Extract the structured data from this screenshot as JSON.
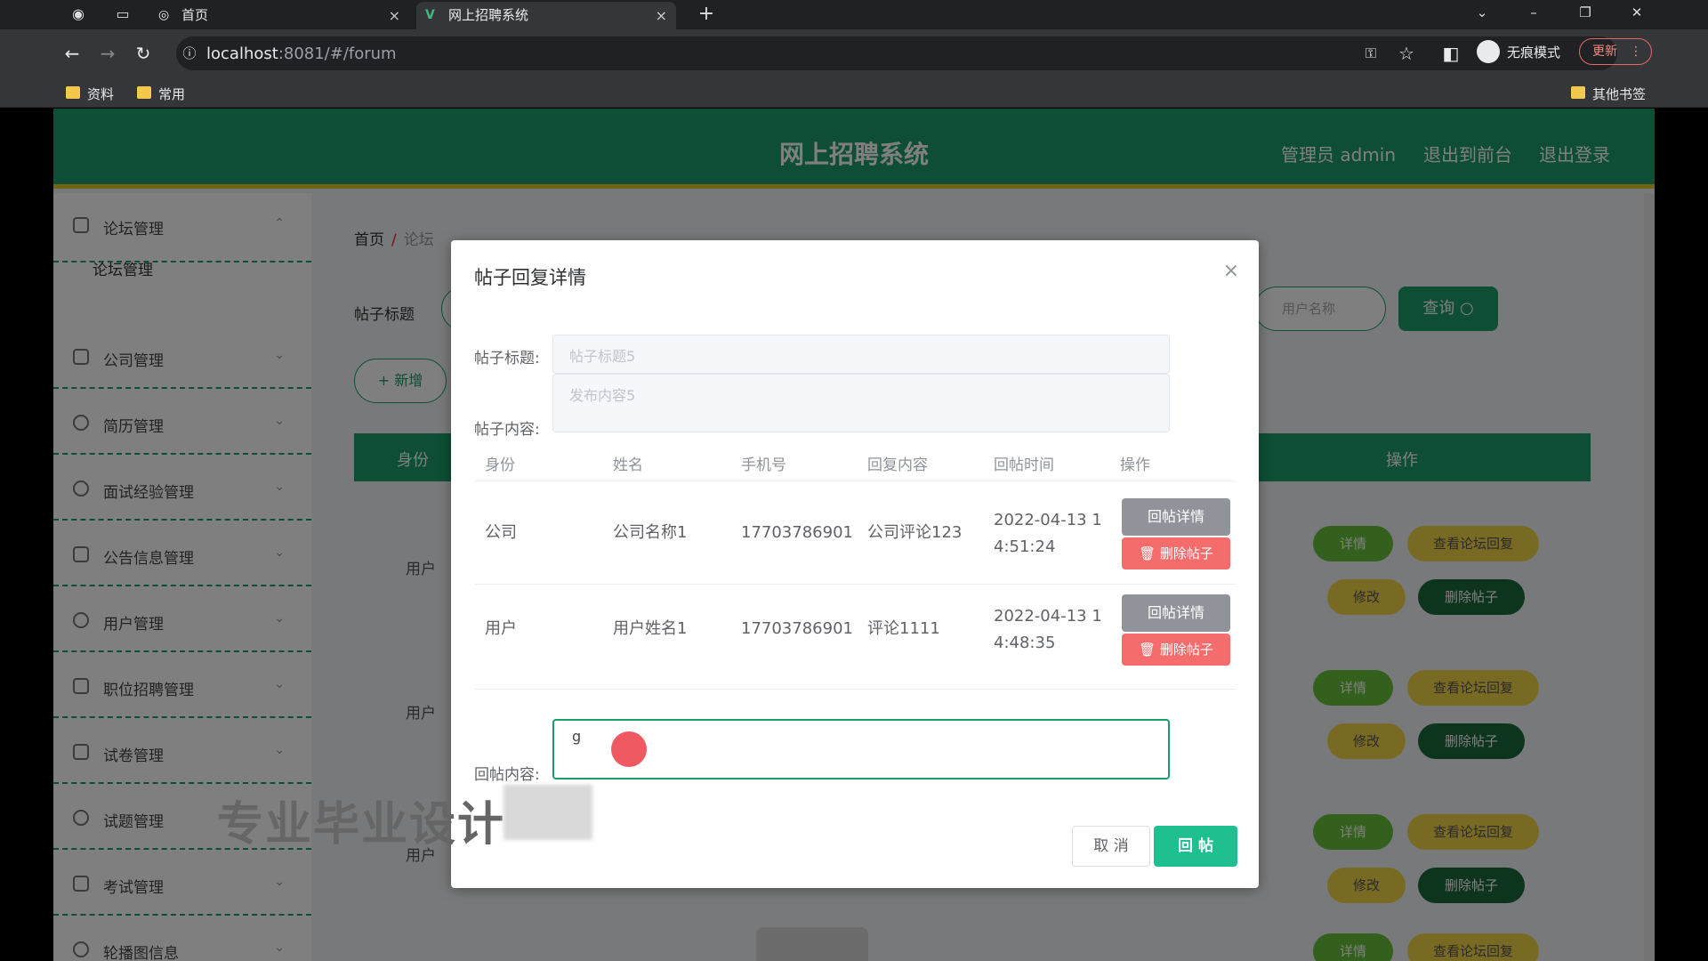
{
  "browser": {
    "tabs": [
      {
        "label": "首页",
        "close": "×"
      },
      {
        "label": "网上招聘系统",
        "close": "×"
      }
    ],
    "new_tab": "+",
    "url_host": "localhost",
    "url_rest": ":8081/#/forum",
    "incognito_label": "无痕模式",
    "update_label": "更新",
    "bookmarks": [
      "资料",
      "常用"
    ],
    "other_bookmarks": "其他书签"
  },
  "header": {
    "title": "网上招聘系统",
    "admin": "管理员 admin",
    "to_front": "退出到前台",
    "logout": "退出登录"
  },
  "sidebar": {
    "items": [
      "论坛管理",
      "公司管理",
      "简历管理",
      "面试经验管理",
      "公告信息管理",
      "用户管理",
      "职位招聘管理",
      "试卷管理",
      "试题管理",
      "考试管理",
      "轮播图信息"
    ],
    "sub_item": "论坛管理"
  },
  "content": {
    "breadcrumb_home": "首页",
    "breadcrumb_sep": "/",
    "breadcrumb_current": "论坛",
    "filter_label": "帖子标题",
    "filter2_placeholder": "用户名称",
    "query_button": "查询",
    "add_button": "+ 新增",
    "table_headers": {
      "identity": "身份",
      "action": "操作"
    },
    "row_labels": [
      "用户",
      "用户",
      "用户"
    ],
    "row_buttons": {
      "detail": "详情",
      "view_reply": "查看论坛回复",
      "edit": "修改",
      "delete": "删除帖子"
    }
  },
  "dialog": {
    "title": "帖子回复详情",
    "close": "×",
    "post_title_label": "帖子标题:",
    "post_title_value": "帖子标题5",
    "post_content_label": "帖子内容:",
    "post_content_value": "发布内容5",
    "table": {
      "headers": [
        "身份",
        "姓名",
        "手机号",
        "回复内容",
        "回帖时间",
        "操作"
      ],
      "rows": [
        {
          "identity": "公司",
          "name": "公司名称1",
          "phone": "17703786901",
          "content": "公司评论123",
          "time_line1": "2022-04-13 1",
          "time_line2": "4:51:24"
        },
        {
          "identity": "用户",
          "name": "用户姓名1",
          "phone": "17703786901",
          "content": "评论1111",
          "time_line1": "2022-04-13 1",
          "time_line2": "4:48:35"
        }
      ],
      "detail_button": "回帖详情",
      "delete_button": "删除帖子"
    },
    "reply_label": "回帖内容:",
    "reply_value": "g",
    "cancel_button": "取 消",
    "submit_button": "回 帖"
  },
  "overlay": {
    "watermark": "专业毕业设计"
  }
}
